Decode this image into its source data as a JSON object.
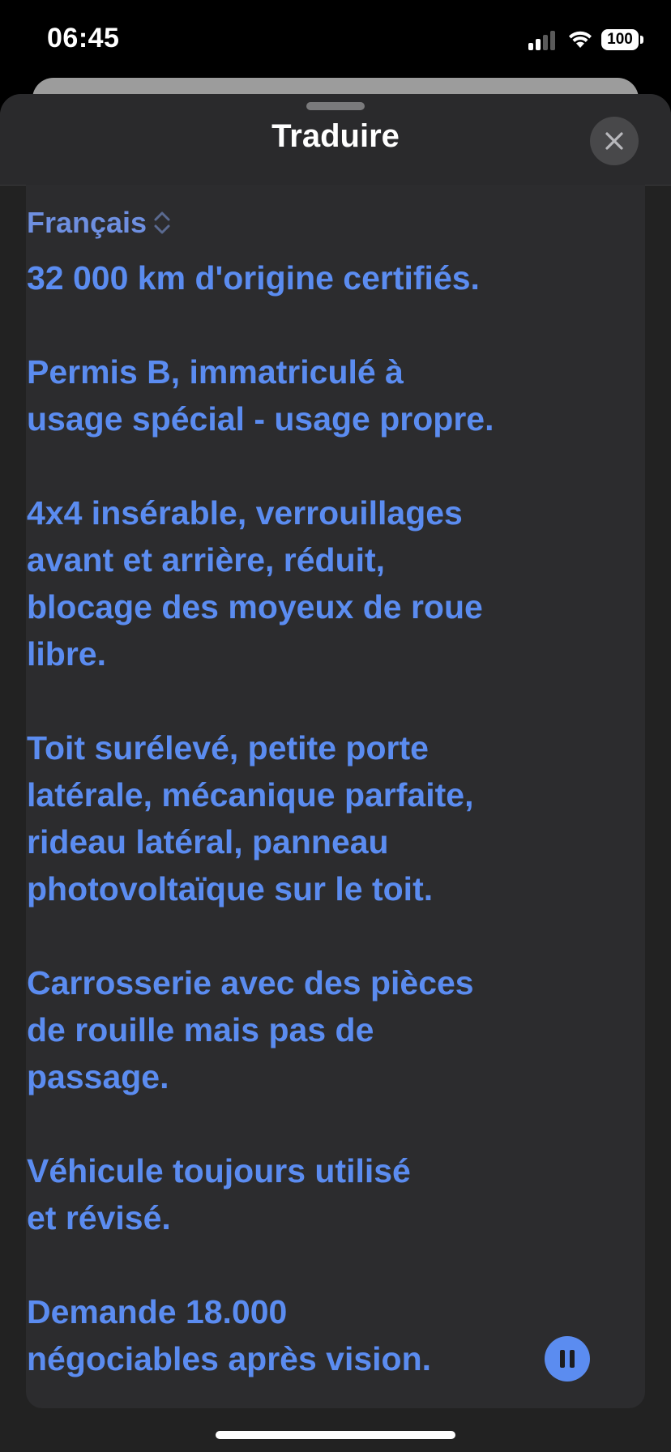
{
  "status_bar": {
    "time": "06:45",
    "battery": "100"
  },
  "sheet": {
    "title": "Traduire"
  },
  "language": {
    "selected": "Français"
  },
  "translation": {
    "paragraphs": [
      "32 000 km d'origine certifiés.",
      "Permis B, immatriculé à\nusage spécial - usage propre.",
      "4x4 insérable, verrouillages\navant et arrière, réduit,\nblocage des moyeux de roue\nlibre.",
      "Toit surélevé, petite porte\nlatérale, mécanique parfaite,\nrideau latéral, panneau\nphotovoltaïque sur le toit.",
      "Carrosserie avec des pièces\nde rouille mais pas de\npassage.",
      "Véhicule toujours utilisé\net révisé.",
      "Demande 18.000\nnégociables après vision."
    ]
  },
  "colors": {
    "accent": "#5b8cf0",
    "sheet_background": "#222222",
    "card_background": "#2c2c2e"
  },
  "icons": {
    "close": "close-icon",
    "pause": "pause-icon",
    "language_picker": "chevron-up-down-icon"
  }
}
